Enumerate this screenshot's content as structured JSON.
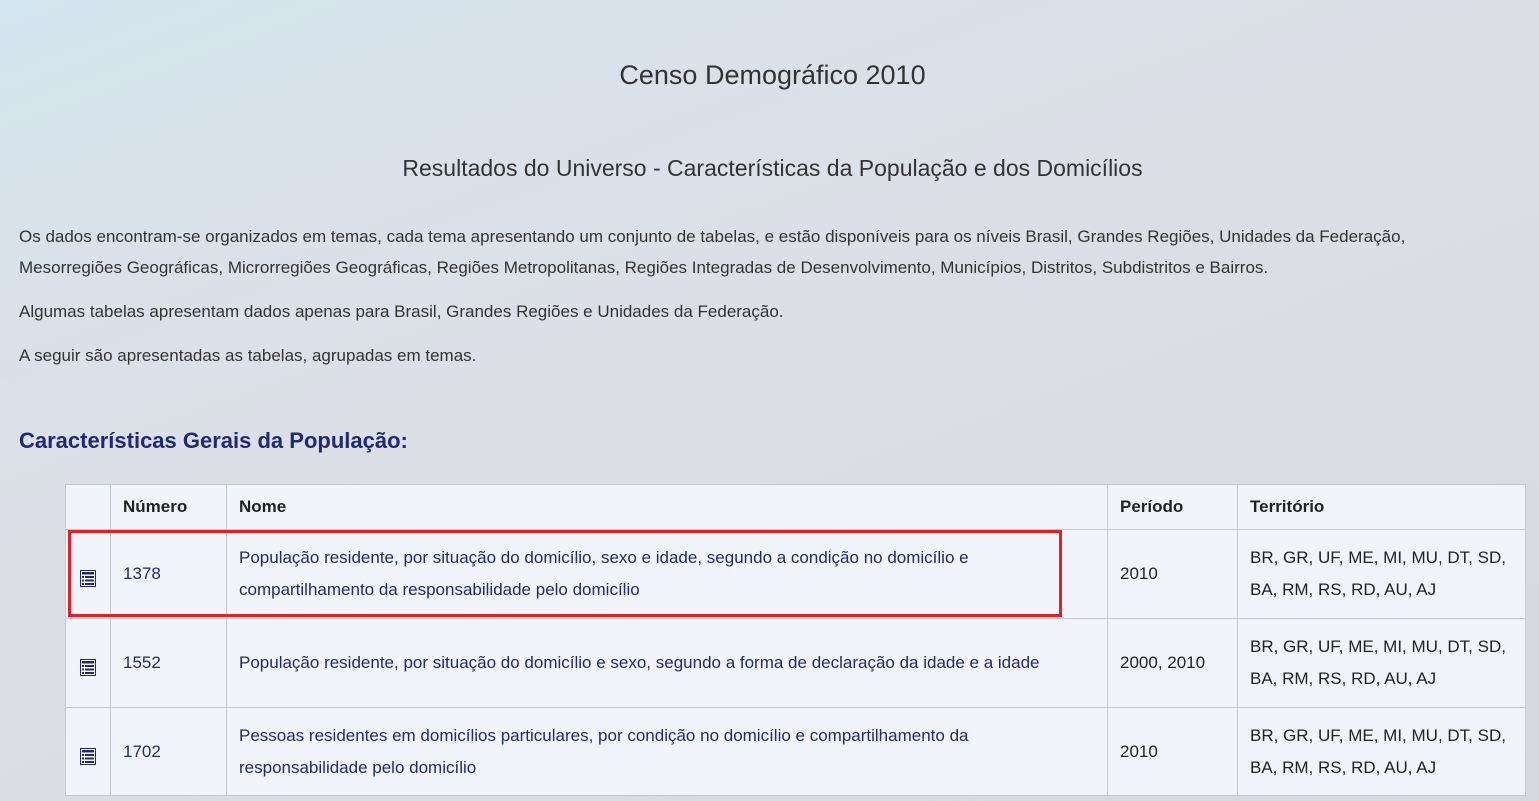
{
  "header": {
    "title": "Censo Demográfico 2010",
    "subtitle": "Resultados do Universo - Características da População e dos Domicílios"
  },
  "intro": {
    "paragraph_1": "Os dados encontram-se organizados em temas, cada tema apresentando um conjunto de tabelas, e estão disponíveis para os níveis Brasil, Grandes Regiões, Unidades da Federação, Mesorregiões Geográficas, Microrregiões Geográficas, Regiões Metropolitanas, Regiões Integradas de Desenvolvimento, Municípios, Distritos, Subdistritos e Bairros.",
    "paragraph_2": "Algumas tabelas apresentam dados apenas para Brasil, Grandes Regiões e Unidades da Federação.",
    "paragraph_3": "A seguir são apresentadas as tabelas, agrupadas em temas."
  },
  "section": {
    "heading": "Características Gerais da População:"
  },
  "table": {
    "headers": {
      "icon": "",
      "number": "Número",
      "name": "Nome",
      "period": "Período",
      "territory": "Território"
    },
    "rows": [
      {
        "icon": "table-list-icon",
        "number": "1378",
        "name": "População residente, por situação do domicílio, sexo e idade, segundo a condição no domicílio e compartilhamento da responsabilidade pelo domicílio",
        "period": "2010",
        "territory": "BR, GR, UF, ME, MI, MU, DT, SD, BA, RM, RS, RD, AU, AJ"
      },
      {
        "icon": "table-list-icon",
        "number": "1552",
        "name": "População residente, por situação do domicílio e sexo, segundo a forma de declaração da idade e a idade",
        "period": "2000, 2010",
        "territory": "BR, GR, UF, ME, MI, MU, DT, SD, BA, RM, RS, RD, AU, AJ"
      },
      {
        "icon": "table-list-icon",
        "number": "1702",
        "name": "Pessoas residentes em domicílios particulares, por condição no domicílio e compartilhamento da responsabilidade pelo domicílio",
        "period": "2010",
        "territory": "BR, GR, UF, ME, MI, MU, DT, SD, BA, RM, RS, RD, AU, AJ"
      }
    ]
  },
  "colors": {
    "link": "#1e2a78",
    "heading": "#1e2a78",
    "highlight": "#e41e26",
    "table_background": "#f1f4fa"
  }
}
